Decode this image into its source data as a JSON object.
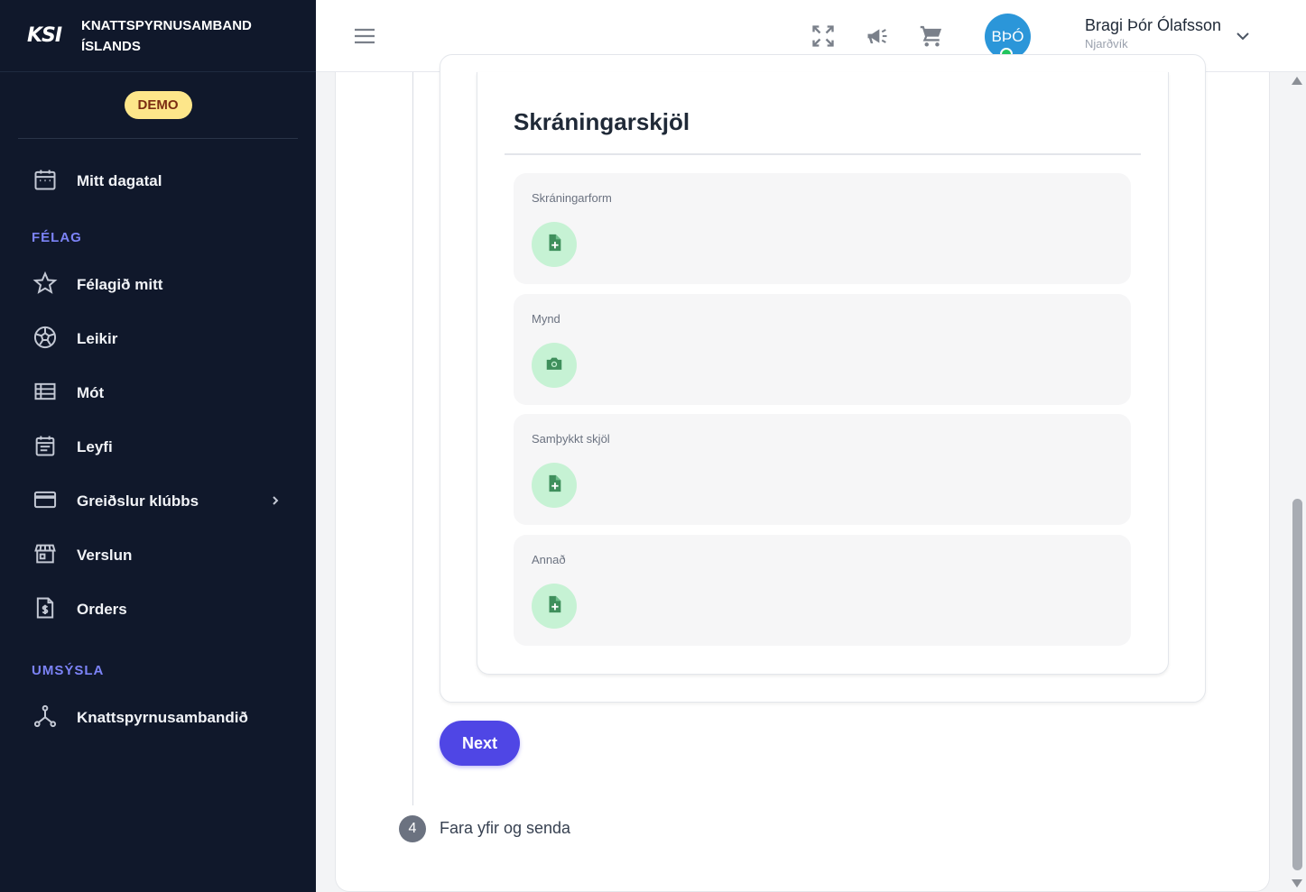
{
  "brand": {
    "logo": "KSI",
    "name_line1": "KNATTSPYRNUSAMBAND",
    "name_line2": "ÍSLANDS"
  },
  "demo_badge": "DEMO",
  "nav": {
    "calendar": "Mitt dagatal",
    "section_club": "FÉLAG",
    "club": "Félagið mitt",
    "games": "Leikir",
    "tournaments": "Mót",
    "licenses": "Leyfi",
    "payments": "Greiðslur klúbbs",
    "store": "Verslun",
    "orders": "Orders",
    "section_admin": "UMSÝSLA",
    "federation": "Knattspyrnusambandið"
  },
  "topbar": {
    "avatar_initials": "BÞÓ",
    "user_name": "Bragi Þór Ólafsson",
    "user_club": "Njarðvík"
  },
  "card": {
    "title": "Skráningarskjöl",
    "rows": [
      {
        "label": "Skráningarform",
        "icon": "file-plus-icon"
      },
      {
        "label": "Mynd",
        "icon": "camera-icon"
      },
      {
        "label": "Samþykkt skjöl",
        "icon": "file-plus-icon"
      },
      {
        "label": "Annað",
        "icon": "file-plus-icon"
      }
    ]
  },
  "next_button": "Next",
  "step": {
    "number": "4",
    "label": "Fara yfir og senda"
  },
  "colors": {
    "sidebar": "#10182b",
    "accent": "#4f46e5",
    "section": "#7c83f7",
    "upload_bg": "#c6f2d4",
    "upload_icon": "#3f8f5c"
  }
}
